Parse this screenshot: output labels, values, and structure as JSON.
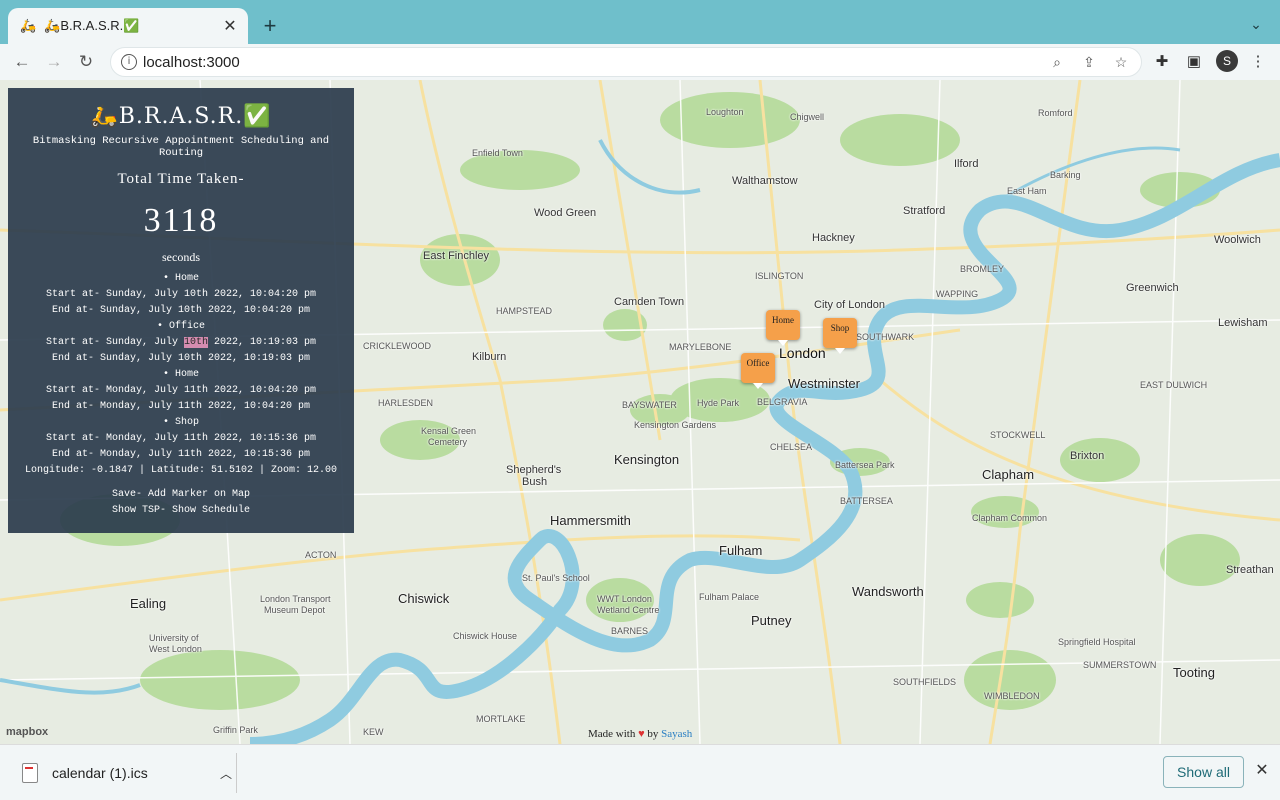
{
  "browser": {
    "tab_title": "🛵B.R.A.S.R.✅",
    "tab_favicon": "🛵",
    "url": "localhost:3000"
  },
  "panel": {
    "title": "🛵B.R.A.S.R.✅",
    "subtitle": "Bitmasking Recursive Appointment Scheduling and Routing",
    "total_label": "Total Time Taken-",
    "total_value": "3118",
    "unit": "seconds",
    "stops": [
      {
        "name": "• Home",
        "start": "Start at- Sunday, July 10th 2022, 10:04:20 pm",
        "end": "End at- Sunday, July 10th 2022, 10:04:20 pm"
      },
      {
        "name": "• Office",
        "start_pre": "Start at- Sunday, July ",
        "start_hl": "10th",
        "start_post": " 2022, 10:19:03 pm",
        "end": "End at- Sunday, July 10th 2022, 10:19:03 pm"
      },
      {
        "name": "• Home",
        "start": "Start at- Monday, July 11th 2022, 10:04:20 pm",
        "end": "End at- Monday, July 11th 2022, 10:04:20 pm"
      },
      {
        "name": "• Shop",
        "start": "Start at- Monday, July 11th 2022, 10:15:36 pm",
        "end": "End at- Monday, July 11th 2022, 10:15:36 pm"
      }
    ],
    "coords": "Longitude: -0.1847 | Latitude: 51.5102 | Zoom: 12.00",
    "help1": "Save- Add Marker on Map",
    "help2": "Show TSP- Show Schedule"
  },
  "map": {
    "markers": {
      "home": "Home",
      "shop": "Shop",
      "office": "Office"
    },
    "places": {
      "london": "London",
      "westminster": "Westminster",
      "city": "City of London",
      "kensington": "Kensington",
      "hammersmith": "Hammersmith",
      "fulham": "Fulham",
      "putney": "Putney",
      "wandsworth": "Wandsworth",
      "clapham": "Clapham",
      "brixton": "Brixton",
      "chiswick": "Chiswick",
      "ealing": "Ealing",
      "shepherds": "Shepherd's",
      "bush": "Bush",
      "kilburn": "Kilburn",
      "camden": "Camden Town",
      "hackney": "Hackney",
      "stratford": "Stratford",
      "ilford": "Ilford",
      "greenwich": "Greenwich",
      "lewisham": "Lewisham",
      "tooting": "Tooting",
      "walthamstow": "Walthamstow",
      "woodgreen": "Wood Green",
      "eastfinchley": "East Finchley",
      "enfield": "Enfield Town",
      "woolwich": "Woolwich",
      "eastham": "East Ham",
      "barking": "Barking",
      "romford": "Romford",
      "streatham": "Streathan",
      "chigwell": "Chigwell",
      "loughton": "Loughton",
      "hydepark": "Hyde Park",
      "battersea": "Battersea Park",
      "wwt": "WWT London",
      "wwt2": "Wetland Centre",
      "springfield": "Springfield Hospital",
      "chiswickhouse": "Chiswick House",
      "griffin": "Griffin Park",
      "stpauls": "St. Paul's School",
      "fulhampalace": "Fulham Palace",
      "londontransport": "London Transport",
      "museumdepot": "Museum Depot",
      "uwl1": "University of",
      "uwl2": "West London",
      "kensal": "Kensal Green",
      "kensal2": "Cemetery",
      "kensgardens": "Kensington Gardens",
      "claphamcommon": "Clapham Common",
      "barnes": "BARNES",
      "mortlake": "MORTLAKE",
      "kew": "KEW",
      "acton": "ACTON",
      "chelsea": "CHELSEA",
      "battersea2": "BATTERSEA",
      "southfields": "SOUTHFIELDS",
      "wimbledon": "WIMBLEDON",
      "summerstown": "SUMMERSTOWN",
      "stockwell": "STOCKWELL",
      "eastdulwich": "EAST DULWICH",
      "bayswater": "BAYSWATER",
      "marylebone": "MARYLEBONE",
      "belgravia": "BELGRAVIA",
      "islington": "ISLINGTON",
      "hampstead": "HAMPSTEAD",
      "cricklewood": "CRICKLEWOOD",
      "harlesden": "HARLESDEN",
      "bromley": "BROMLEY",
      "wapping": "WAPPING",
      "southwark": "SOUTHWARK"
    },
    "mapbox": "mapbox",
    "credit_pre": "Made with ",
    "credit_heart": "♥",
    "credit_by": " by ",
    "credit_author": "Sayash"
  },
  "downloads": {
    "file": "calendar (1).ics",
    "show_all": "Show all"
  },
  "colors": {
    "tabstrip": "#6fbfcb",
    "panel": "#2c3c4e",
    "marker": "#f5a04a",
    "river": "#8fcbe0",
    "park": "#b9dca0"
  }
}
